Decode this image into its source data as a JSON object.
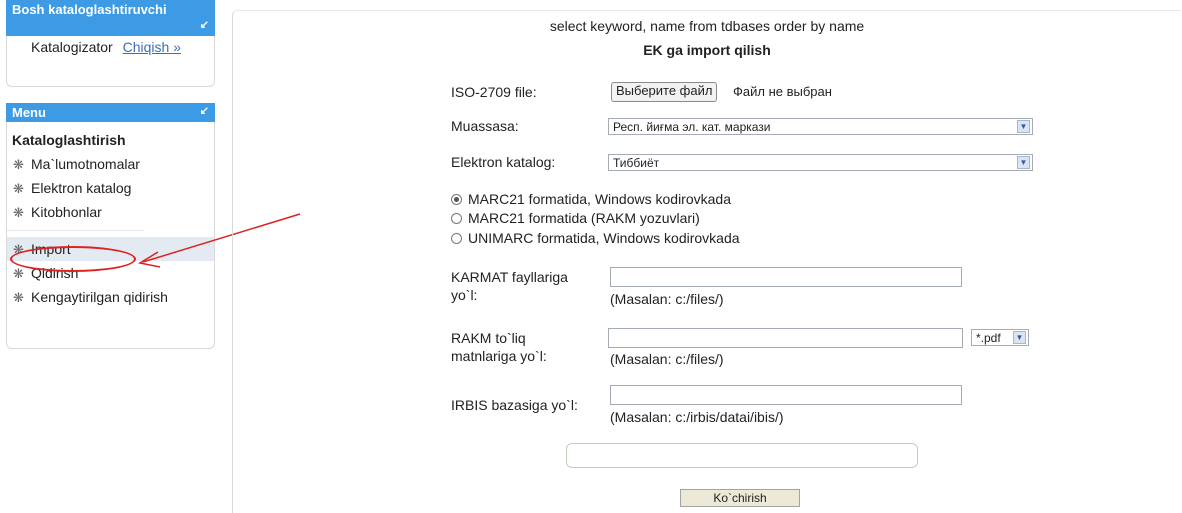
{
  "sidebar": {
    "box1": {
      "title": "Bosh kataloglashtiruvchi",
      "user_label": "Katalogizator",
      "logout_label": "Chiqish »"
    },
    "menu": {
      "title": "Menu",
      "section": "Kataloglashtirish",
      "group1": [
        "Ma`lumotnomalar",
        "Elektron katalog",
        "Kitobhonlar"
      ],
      "group2": [
        "Import",
        "Qidirish",
        "Kengaytirilgan qidirish"
      ],
      "active": "Import"
    }
  },
  "main": {
    "sql_text": "select keyword, name from tdbases order by name",
    "title": "EK ga import qilish",
    "iso_label": "ISO-2709 file:",
    "file_button": "Выберите файл",
    "file_status": "Файл не выбран",
    "muassasa_label": "Muassasa:",
    "muassasa_value": "Респ. йиғма эл. кат. маркази",
    "katalog_label": "Elektron katalog:",
    "katalog_value": "Тиббиёт",
    "radios": [
      {
        "label": "MARC21 formatida, Windows kodirovkada",
        "checked": true
      },
      {
        "label": "MARC21 formatida (RAKM yozuvlari)",
        "checked": false
      },
      {
        "label": "UNIMARC formatida, Windows kodirovkada",
        "checked": false
      }
    ],
    "karmat_label_1": "KARMAT fayllariga",
    "karmat_label_2": "yo`l:",
    "karmat_hint": "(Masalan: c:/files/)",
    "rakm_label_1": "RAKM to`liq",
    "rakm_label_2": "matnlariga yo`l:",
    "rakm_hint": "(Masalan: c:/files/)",
    "rakm_ext": "*.pdf",
    "irbis_label": "IRBIS bazasiga yo`l:",
    "irbis_hint": "(Masalan: c:/irbis/datai/ibis/)",
    "copy_button": "Ko`chirish"
  },
  "colors": {
    "accent": "#3d9be6",
    "annotation": "#d22222"
  },
  "icons": {
    "pin": "pin-icon",
    "menu_item": "books-icon"
  }
}
